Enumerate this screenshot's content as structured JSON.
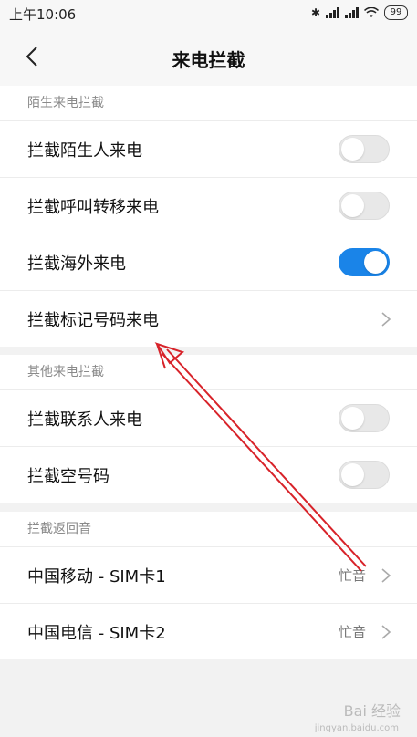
{
  "status_bar": {
    "time": "上午10:06",
    "battery": "99"
  },
  "header": {
    "title": "来电拦截"
  },
  "sections": [
    {
      "title": "陌生来电拦截",
      "rows": [
        {
          "label": "拦截陌生人来电",
          "toggle": "off"
        },
        {
          "label": "拦截呼叫转移来电",
          "toggle": "off"
        },
        {
          "label": "拦截海外来电",
          "toggle": "on"
        },
        {
          "label": "拦截标记号码来电",
          "chevron": true
        }
      ]
    },
    {
      "title": "其他来电拦截",
      "rows": [
        {
          "label": "拦截联系人来电",
          "toggle": "off"
        },
        {
          "label": "拦截空号码",
          "toggle": "off"
        }
      ]
    },
    {
      "title": "拦截返回音",
      "rows": [
        {
          "label": "中国移动 - SIM卡1",
          "value": "忙音",
          "chevron": true
        },
        {
          "label": "中国电信 - SIM卡2",
          "value": "忙音",
          "chevron": true
        }
      ]
    }
  ],
  "colors": {
    "accent": "#1a84e8",
    "annotation_arrow": "#d8232a"
  },
  "watermark": {
    "text": "Bai 经验",
    "url": "jingyan.baidu.com"
  }
}
